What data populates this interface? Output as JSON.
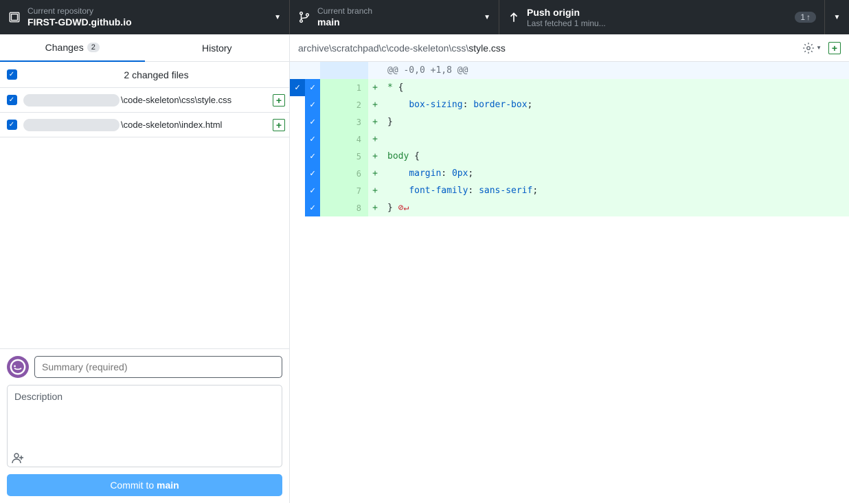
{
  "header": {
    "repo_label": "Current repository",
    "repo_name": "FIRST-GDWD.github.io",
    "branch_label": "Current branch",
    "branch_name": "main",
    "push_label": "Push origin",
    "push_sub": "Last fetched 1 minu...",
    "push_count": "1"
  },
  "tabs": {
    "changes": "Changes",
    "changes_count": "2",
    "history": "History"
  },
  "files": {
    "header": "2 changed files",
    "row1_path": "\\code-skeleton\\css\\style.css",
    "row2_path": "\\code-skeleton\\index.html"
  },
  "commit": {
    "summary_placeholder": "Summary (required)",
    "desc_placeholder": "Description",
    "button_prefix": "Commit to ",
    "button_branch": "main"
  },
  "diff": {
    "path_prefix": "archive\\scratchpad\\c\\code-skeleton\\css\\",
    "path_file": "style.css",
    "hunk": "@@ -0,0 +1,8 @@",
    "lines": {
      "n1": "1",
      "n2": "2",
      "n3": "3",
      "n4": "4",
      "n5": "5",
      "n6": "6",
      "n7": "7",
      "n8": "8",
      "l1_a": "* ",
      "l1_b": "{",
      "l2_a": "    ",
      "l2_b": "box-sizing",
      "l2_c": ": ",
      "l2_d": "border-box",
      "l2_e": ";",
      "l3_a": "}",
      "l4_a": "",
      "l5_a": "body ",
      "l5_b": "{",
      "l6_a": "    ",
      "l6_b": "margin",
      "l6_c": ": ",
      "l6_d": "0px",
      "l6_e": ";",
      "l7_a": "    ",
      "l7_b": "font-family",
      "l7_c": ": ",
      "l7_d": "sans-serif",
      "l7_e": ";",
      "l8_a": "} ",
      "l8_eol": "⊘↵"
    }
  }
}
